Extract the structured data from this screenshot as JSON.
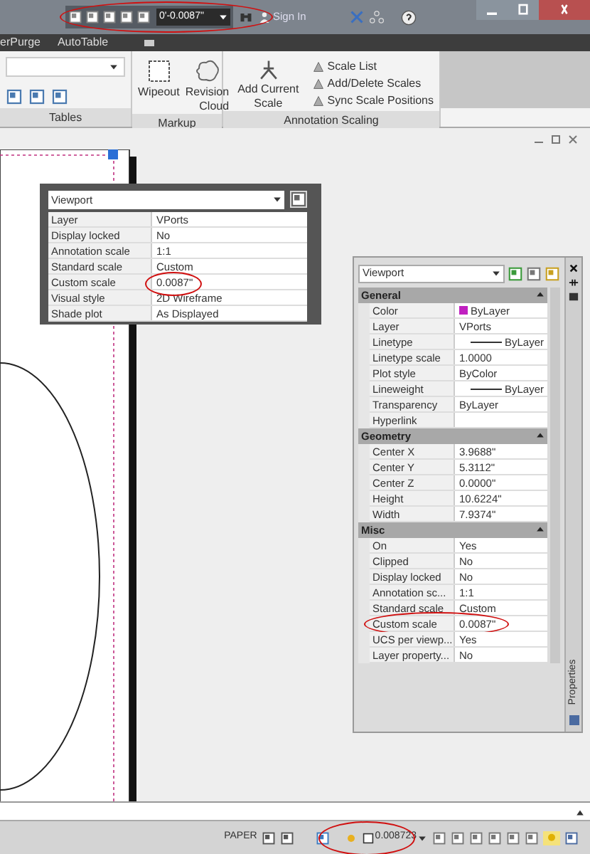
{
  "title_bar": {
    "scale_value": "0'-0.0087\"",
    "sign_in": "Sign In"
  },
  "ribbon_tabs": [
    {
      "label": "erPurge"
    },
    {
      "label": "AutoTable"
    }
  ],
  "ribbon_panels": [
    {
      "title": "Tables",
      "kind": "tables"
    },
    {
      "title": "Markup",
      "kind": "markup",
      "buttons": [
        "Wipeout",
        "Revision Cloud"
      ]
    },
    {
      "title": "Annotation Scaling",
      "kind": "scaling",
      "large": "Add Current Scale",
      "small": [
        "Scale List",
        "Add/Delete Scales",
        "Sync Scale Positions"
      ]
    }
  ],
  "quick_properties": {
    "object": "Viewport",
    "rows": [
      {
        "name": "Layer",
        "value": "VPorts"
      },
      {
        "name": "Display locked",
        "value": "No"
      },
      {
        "name": "Annotation scale",
        "value": "1:1"
      },
      {
        "name": "Standard scale",
        "value": "Custom"
      },
      {
        "name": "Custom scale",
        "value": "0.0087\""
      },
      {
        "name": "Visual style",
        "value": "2D Wireframe"
      },
      {
        "name": "Shade plot",
        "value": "As Displayed"
      }
    ]
  },
  "properties": {
    "object": "Viewport",
    "tab_label": "Properties",
    "sections": [
      {
        "title": "General",
        "expanded": true,
        "rows": [
          {
            "name": "Color",
            "value": "ByLayer",
            "kind": "color",
            "color": "#c020c0"
          },
          {
            "name": "Layer",
            "value": "VPorts",
            "kind": "text"
          },
          {
            "name": "Linetype",
            "value": "ByLayer",
            "kind": "line"
          },
          {
            "name": "Linetype scale",
            "value": "1.0000",
            "kind": "text"
          },
          {
            "name": "Plot style",
            "value": "ByColor",
            "kind": "text"
          },
          {
            "name": "Lineweight",
            "value": "ByLayer",
            "kind": "line"
          },
          {
            "name": "Transparency",
            "value": "ByLayer",
            "kind": "text"
          },
          {
            "name": "Hyperlink",
            "kind": "text"
          }
        ]
      },
      {
        "title": "Geometry",
        "expanded": true,
        "rows": [
          {
            "name": "Center X",
            "value": "3.9688\"",
            "kind": "text"
          },
          {
            "name": "Center Y",
            "value": "5.3112\"",
            "kind": "text"
          },
          {
            "name": "Center Z",
            "value": "0.0000\"",
            "kind": "text"
          },
          {
            "name": "Height",
            "value": "10.6224\"",
            "kind": "text"
          },
          {
            "name": "Width",
            "value": "7.9374\"",
            "kind": "text"
          }
        ]
      },
      {
        "title": "Misc",
        "expanded": true,
        "rows": [
          {
            "name": "On",
            "value": "Yes",
            "kind": "text"
          },
          {
            "name": "Clipped",
            "value": "No",
            "kind": "text"
          },
          {
            "name": "Display locked",
            "value": "No",
            "kind": "text"
          },
          {
            "name": "Annotation sc...",
            "value": "1:1",
            "kind": "text"
          },
          {
            "name": "Standard scale",
            "value": "Custom",
            "kind": "text"
          },
          {
            "name": "Custom scale",
            "value": "0.0087\"",
            "kind": "text"
          },
          {
            "name": "UCS per viewp...",
            "value": "Yes",
            "kind": "text"
          },
          {
            "name": "Layer property...",
            "value": "No",
            "kind": "text"
          }
        ]
      }
    ]
  },
  "status_bar": {
    "space": "PAPER",
    "scale": "0.008723"
  }
}
